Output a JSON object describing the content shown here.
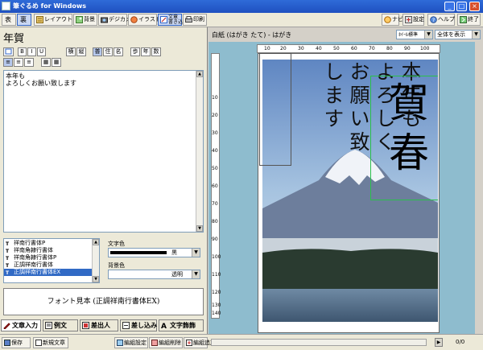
{
  "window": {
    "title": "筆ぐるめ for Windows",
    "controls": [
      "_",
      "□",
      "×"
    ]
  },
  "toolbar": {
    "items": [
      {
        "label": "表",
        "icon": "omote-icon"
      },
      {
        "label": "裏",
        "icon": "ura-icon"
      },
      {
        "label": "レイアウト",
        "icon": "layout-icon"
      },
      {
        "label": "背景",
        "icon": "background-icon"
      },
      {
        "label": "デジカメ",
        "icon": "camera-icon"
      },
      {
        "label": "イラスト",
        "icon": "illustration-icon"
      },
      {
        "label": "文章\n書き込み",
        "icon": "write-text-icon"
      },
      {
        "label": "印刷",
        "icon": "print-icon"
      }
    ],
    "right_items": [
      {
        "label": "ナビ",
        "icon": "navi-icon"
      },
      {
        "label": "設定",
        "icon": "settings-icon"
      },
      {
        "label": "ヘルプ",
        "icon": "help-icon"
      },
      {
        "label": "終了",
        "icon": "exit-icon"
      }
    ]
  },
  "left": {
    "heading": "年賀",
    "format_buttons": [
      "B",
      "I",
      "U",
      "横",
      "縦",
      "普",
      "住",
      "名",
      "歩",
      "年",
      "数"
    ],
    "align_buttons": [
      "≡",
      "≡",
      "≡",
      "▦",
      "▦"
    ],
    "editor_text": "本年も\nよろしくお願い致します",
    "fonts": [
      {
        "name": "祥南行書体P",
        "selected": false
      },
      {
        "name": "祥南角隷行書体",
        "selected": false
      },
      {
        "name": "祥南角隷行書体P",
        "selected": false
      },
      {
        "name": "正調祥南行書体",
        "selected": false
      },
      {
        "name": "正調祥南行書体EX",
        "selected": true
      }
    ],
    "text_color_label": "文字色",
    "text_color_value": "黒",
    "bg_color_label": "背景色",
    "bg_color_value": "透明",
    "font_preview": "フォント見本 (正調祥南行書体EX)",
    "tabs": [
      {
        "label": "文章入力",
        "icon": "text-input-icon",
        "selected": true
      },
      {
        "label": "例文",
        "icon": "sample-text-icon",
        "selected": false
      },
      {
        "label": "差出人",
        "icon": "sender-icon",
        "selected": false
      },
      {
        "label": "差し込み",
        "icon": "insert-icon",
        "selected": false
      },
      {
        "label": "文字飾飾",
        "icon": "decoration-icon",
        "selected": false
      }
    ]
  },
  "right": {
    "doc_title": "白紙 (はがき たて) - はがき",
    "zoom_select": "ﾈｲｰﾙ標準",
    "view_select": "全体を表示",
    "ruler_h": [
      "10",
      "20",
      "30",
      "40",
      "50",
      "60",
      "70",
      "80",
      "90",
      "100"
    ],
    "ruler_v": [
      "10",
      "20",
      "30",
      "40",
      "50",
      "60",
      "70",
      "80",
      "90",
      "100",
      "110",
      "120",
      "130",
      "140"
    ],
    "card_text_columns": [
      "本年も",
      "よろしく",
      "お願い致",
      "します"
    ],
    "card_title": "賀春"
  },
  "status": {
    "items": [
      {
        "label": "保存",
        "icon": "save-icon"
      },
      {
        "label": "新規文章",
        "icon": "new-doc-icon"
      }
    ],
    "edit_buttons": [
      {
        "label": "編組設定",
        "icon": "edit-settings-icon"
      },
      {
        "label": "編組削除",
        "icon": "edit-delete-icon"
      },
      {
        "label": "編組追加",
        "icon": "edit-add-icon"
      }
    ],
    "page_count": "0/0"
  },
  "colors": {
    "titlebar": "#1f50c0",
    "canvas_bg": "#8ebcce",
    "selection": "#316ac5"
  }
}
